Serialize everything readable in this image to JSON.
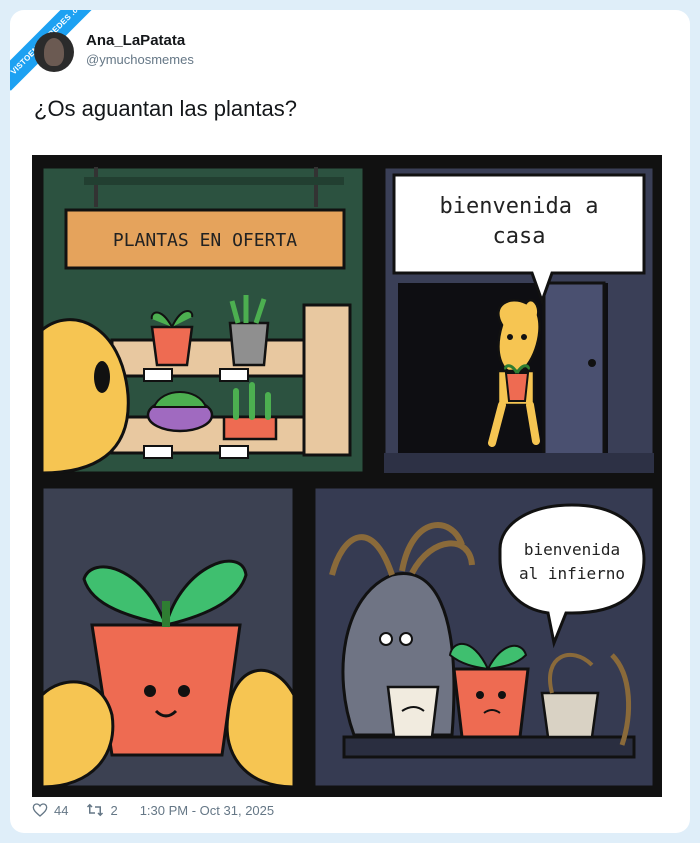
{
  "watermark": "VISTOENLASREDES .com",
  "author": {
    "name": "Ana_LaPatata",
    "handle": "@ymuchosmemes"
  },
  "tweet": {
    "text": "¿Os aguantan las plantas?"
  },
  "comic": {
    "panel1_sign": "PLANTAS EN OFERTA",
    "panel2_bubble_line1": "bienvenida a",
    "panel2_bubble_line2": "casa",
    "panel4_bubble_line1": "bienvenida",
    "panel4_bubble_line2": "al infierno"
  },
  "stats": {
    "likes": "44",
    "retweets": "2",
    "timestamp": "1:30 PM - Oct 31, 2025"
  },
  "icons": {
    "like": "heart-icon",
    "retweet": "retweet-icon"
  },
  "colors": {
    "accent": "#1da1f2",
    "background": "#dfeef9"
  }
}
